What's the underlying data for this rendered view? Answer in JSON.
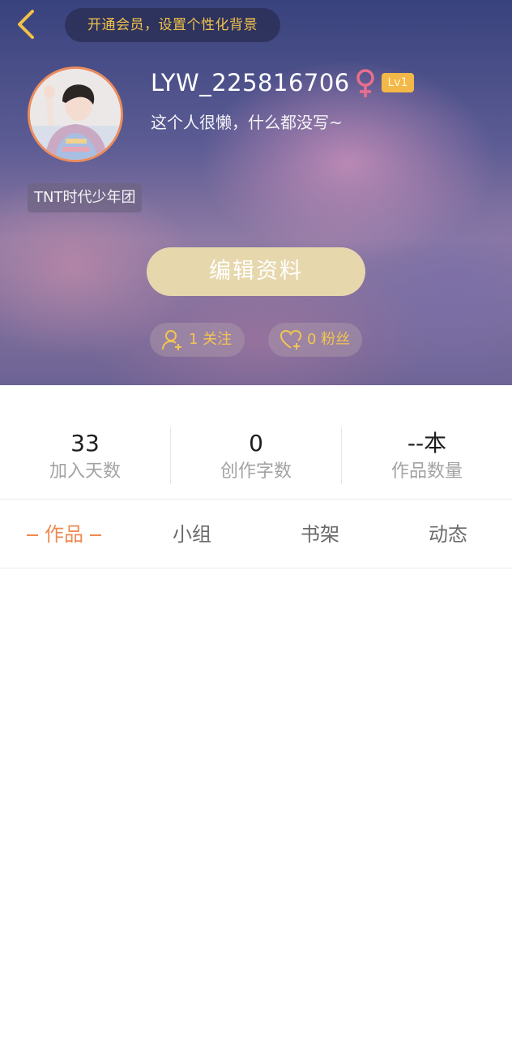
{
  "header": {
    "vip_banner": "开通会员，设置个性化背景",
    "username": "LYW_225816706",
    "level": "Lv1",
    "bio": "这个人很懒，什么都没写~",
    "tag": "TNT时代少年团",
    "edit_button": "编辑资料",
    "follow_count_label": "1 关注",
    "fans_count_label": "0 粉丝",
    "icons": {
      "back": "chevron-left-icon",
      "gender": "female-icon",
      "follow": "user-plus-icon",
      "fans": "heart-plus-icon"
    },
    "colors": {
      "accent_gold": "#f1c24a",
      "level_badge": "#f3b847",
      "gender_pink": "#e96f8c",
      "avatar_border": "#ec8c5d",
      "edit_button": "#e6d7ac"
    }
  },
  "stats": [
    {
      "value": "33",
      "label": "加入天数"
    },
    {
      "value": "0",
      "label": "创作字数"
    },
    {
      "value": "--本",
      "label": "作品数量"
    }
  ],
  "tabs": [
    {
      "label": "作品",
      "active": true
    },
    {
      "label": "小组",
      "active": false
    },
    {
      "label": "书架",
      "active": false
    },
    {
      "label": "动态",
      "active": false
    }
  ],
  "colors": {
    "active_tab": "#ee8a52",
    "inactive_tab": "#6b6b6b"
  }
}
